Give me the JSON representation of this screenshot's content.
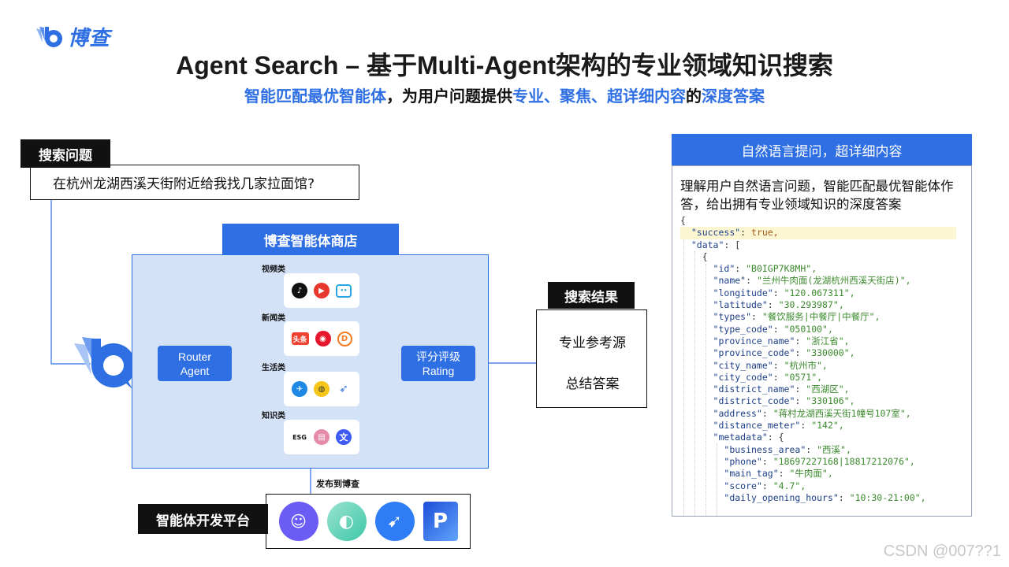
{
  "brand": {
    "name": "博查",
    "color": "#2f6fe4"
  },
  "title": "Agent Search – 基于Multi-Agent架构的专业领域知识搜索",
  "subtitle": {
    "part1": "智能匹配最优智能体",
    "part2": "，为用户问题提供",
    "part3": "专业、聚焦、超详细内容",
    "part4": "的",
    "part5": "深度答案"
  },
  "query": {
    "label": "搜索问题",
    "text": "在杭州龙湖西溪天街附近给我找几家拉面馆?"
  },
  "store": {
    "title": "博查智能体商店",
    "router": {
      "line1": "Router",
      "line2": "Agent"
    },
    "rating": {
      "line1": "评分评级",
      "line2": "Rating"
    },
    "categories": [
      {
        "label": "视频类",
        "icons": [
          "douyin-icon",
          "youku-icon",
          "bilibili-icon"
        ]
      },
      {
        "label": "新闻类",
        "icons": [
          "toutiao-icon",
          "weibo-icon",
          "news-d-icon"
        ]
      },
      {
        "label": "生活类",
        "icons": [
          "flight-icon",
          "meituan-icon",
          "ride-icon"
        ]
      },
      {
        "label": "知识类",
        "icons": [
          "esg-icon",
          "book-icon",
          "wen-icon"
        ]
      }
    ],
    "icon_texts": {
      "toutiao": "头条",
      "esg": "ESG",
      "wen": "文"
    }
  },
  "results": {
    "label": "搜索结果",
    "item1": "专业参考源",
    "item2": "总结答案"
  },
  "platform": {
    "label": "智能体开发平台",
    "publish_label": "发布到博查",
    "icons": [
      "doubao-icon",
      "zhipu-icon",
      "dingtalk-icon",
      "p-platform-icon"
    ]
  },
  "right_panel": {
    "header": "自然语言提问，超详细内容",
    "description": "理解用户自然语言问题，智能匹配最优智能体作答，给出拥有专业领域知识的深度答案",
    "json": {
      "success": "true,",
      "data_open": "[",
      "id": "\"B0IGP7K8MH\",",
      "name": "\"兰州牛肉面(龙湖杭州西溪天街店)\",",
      "longitude": "\"120.067311\",",
      "latitude": "\"30.293987\",",
      "types": "\"餐饮服务|中餐厅|中餐厅\",",
      "type_code": "\"050100\",",
      "province_name": "\"浙江省\",",
      "province_code": "\"330000\",",
      "city_name": "\"杭州市\",",
      "city_code": "\"0571\",",
      "district_name": "\"西湖区\",",
      "district_code": "\"330106\",",
      "address": "\"蒋村龙湖西溪天街1幢号107室\",",
      "distance_meter": "\"142\",",
      "metadata_open": "{",
      "business_area": "\"西溪\",",
      "phone": "\"18697227168|18817212076\",",
      "main_tag": "\"牛肉面\",",
      "score": "\"4.7\",",
      "daily_opening_hours": "\"10:30-21:00\","
    }
  },
  "watermark": "CSDN @007??1"
}
